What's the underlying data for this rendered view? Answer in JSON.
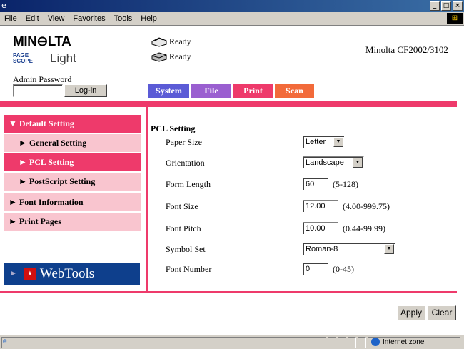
{
  "window": {
    "app_icon": "ie-icon",
    "controls": [
      "_",
      "□",
      "×"
    ]
  },
  "menu": [
    "File",
    "Edit",
    "View",
    "Favorites",
    "Tools",
    "Help"
  ],
  "header": {
    "brand": "MIN⊖LTA",
    "pagescope_badge": "PAGE SCOPE",
    "pagescope_text": "Light",
    "status": [
      "Ready",
      "Ready"
    ],
    "model": "Minolta CF2002/3102",
    "admin_label": "Admin Password",
    "admin_value": "",
    "login_button": "Log-in"
  },
  "tabs": [
    {
      "label": "System",
      "color": "#5b5bd6"
    },
    {
      "label": "File",
      "color": "#9a5fd0"
    },
    {
      "label": "Print",
      "color": "#ee3a6b"
    },
    {
      "label": "Scan",
      "color": "#f26a3a"
    }
  ],
  "sidebar": {
    "items": [
      {
        "label": "▼ Default Setting",
        "level": "top",
        "state": "active"
      },
      {
        "label": "► General Setting",
        "level": "sub",
        "state": "normal"
      },
      {
        "label": "► PCL Setting",
        "level": "sub",
        "state": "selected"
      },
      {
        "label": "► PostScript Setting",
        "level": "sub",
        "state": "normal"
      },
      {
        "label": "► Font Information",
        "level": "top",
        "state": "normal"
      },
      {
        "label": "► Print Pages",
        "level": "top",
        "state": "normal"
      }
    ],
    "webtools_label": "WebTools",
    "webtools_arrow": "►"
  },
  "main": {
    "title": "PCL Setting",
    "fields": [
      {
        "label": "Paper Size",
        "type": "select",
        "value": "Letter"
      },
      {
        "label": "Orientation",
        "type": "select",
        "value": "Landscape"
      },
      {
        "label": "Form Length",
        "type": "text",
        "value": "60",
        "hint": "(5-128)"
      },
      {
        "label": "Font Size",
        "type": "text",
        "value": "12.00",
        "hint": "(4.00-999.75)"
      },
      {
        "label": "Font Pitch",
        "type": "text",
        "value": "10.00",
        "hint": "(0.44-99.99)"
      },
      {
        "label": "Symbol Set",
        "type": "select",
        "value": "Roman-8"
      },
      {
        "label": "Font Number",
        "type": "text",
        "value": "0",
        "hint": "(0-45)"
      }
    ],
    "apply": "Apply",
    "clear": "Clear"
  },
  "statusbar": {
    "zone": "Internet zone"
  },
  "colors": {
    "accent": "#ee3a6b",
    "sidebar_light": "#f9c5cf",
    "webtools_bg": "#0e3f8c"
  }
}
